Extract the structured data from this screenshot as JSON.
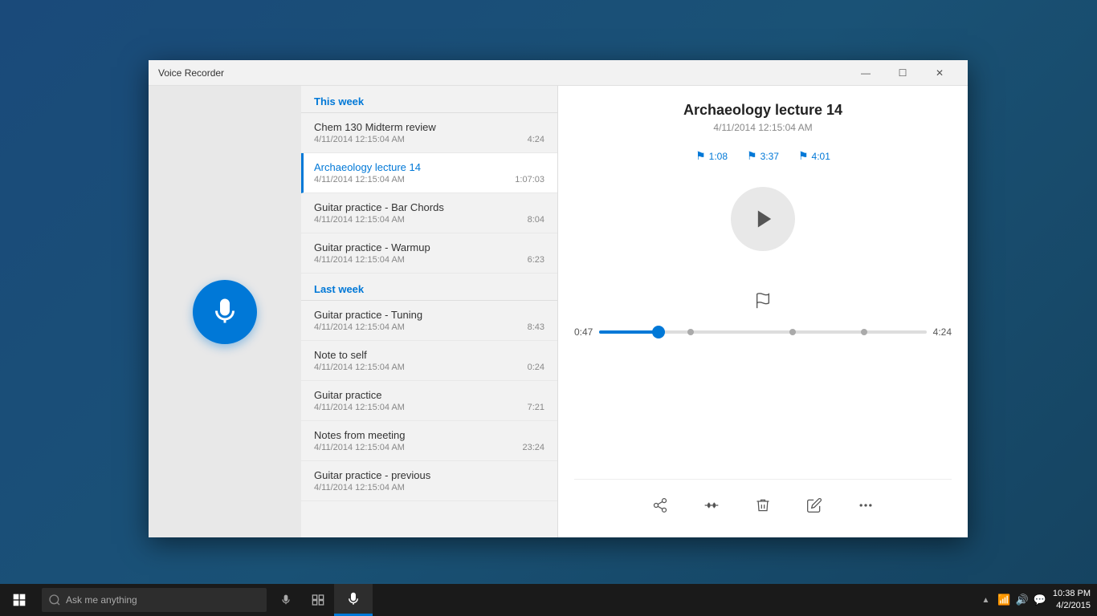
{
  "window": {
    "title": "Voice Recorder",
    "min_label": "—",
    "max_label": "☐",
    "close_label": "✕"
  },
  "recording_selected": {
    "title": "Archaeology lecture 14",
    "date": "4/11/2014 12:15:04 AM",
    "markers": [
      {
        "time": "1:08"
      },
      {
        "time": "3:37"
      },
      {
        "time": "4:01"
      }
    ],
    "progress_current": "0:47",
    "progress_total": "4:24",
    "progress_percent": 18
  },
  "sections": [
    {
      "label": "This week",
      "items": [
        {
          "name": "Chem 130 Midterm review",
          "date": "4/11/2014 12:15:04 AM",
          "duration": "4:24",
          "selected": false
        },
        {
          "name": "Archaeology lecture 14",
          "date": "4/11/2014 12:15:04 AM",
          "duration": "1:07:03",
          "selected": true
        },
        {
          "name": "Guitar practice - Bar Chords",
          "date": "4/11/2014 12:15:04 AM",
          "duration": "8:04",
          "selected": false
        },
        {
          "name": "Guitar practice - Warmup",
          "date": "4/11/2014 12:15:04 AM",
          "duration": "6:23",
          "selected": false
        }
      ]
    },
    {
      "label": "Last week",
      "items": [
        {
          "name": "Guitar practice - Tuning",
          "date": "4/11/2014 12:15:04 AM",
          "duration": "8:43",
          "selected": false
        },
        {
          "name": "Note to self",
          "date": "4/11/2014 12:15:04 AM",
          "duration": "0:24",
          "selected": false
        },
        {
          "name": "Guitar practice",
          "date": "4/11/2014 12:15:04 AM",
          "duration": "7:21",
          "selected": false
        },
        {
          "name": "Notes from meeting",
          "date": "4/11/2014 12:15:04 AM",
          "duration": "23:24",
          "selected": false
        },
        {
          "name": "Guitar practice - previous",
          "date": "4/11/2014 12:15:04 AM",
          "duration": "",
          "selected": false
        }
      ]
    }
  ],
  "taskbar": {
    "search_placeholder": "Ask me anything",
    "clock_time": "10:38 PM",
    "clock_date": "4/2/2015"
  }
}
